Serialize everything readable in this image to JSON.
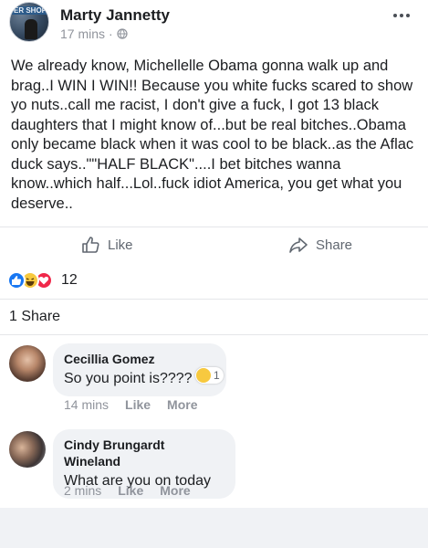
{
  "post": {
    "author": "Marty Jannetty",
    "time": "17 mins",
    "separator": "·",
    "avatar_sign": "ER SHOP",
    "text": "We already know, Michellelle Obama gonna walk up and brag..I WIN I WIN!! Because you white fucks scared to show yo nuts..call me racist, I don't give a fuck, I got 13 black daughters that I might know of...but be real bitches..Obama only became black when it was cool to be black..as the Aflac duck says..\"\"HALF BLACK\"....I bet bitches wanna know..which half...Lol..fuck idiot America, you get what you deserve.."
  },
  "actions": {
    "like_label": "Like",
    "share_label": "Share"
  },
  "reactions": {
    "types": [
      "like",
      "haha",
      "love"
    ],
    "count": "12"
  },
  "shares": "1 Share",
  "comments": [
    {
      "author": "Cecillia Gomez",
      "text": "So you point is????",
      "time": "14 mins",
      "like": "Like",
      "more": "More",
      "reaction_count": "1"
    },
    {
      "author": "Cindy Brungardt Wineland",
      "text": "What are you on today",
      "time": "2 mins",
      "like": "Like",
      "more": "More"
    }
  ],
  "colors": {
    "facebook_blue": "#1877f2",
    "text": "#1c1e21",
    "muted": "#90949c",
    "bubble": "#f0f2f5"
  },
  "icons": [
    "globe-icon",
    "more-icon",
    "like-thumb-icon",
    "share-arrow-icon",
    "like-reaction-icon",
    "haha-reaction-icon",
    "love-reaction-icon"
  ]
}
